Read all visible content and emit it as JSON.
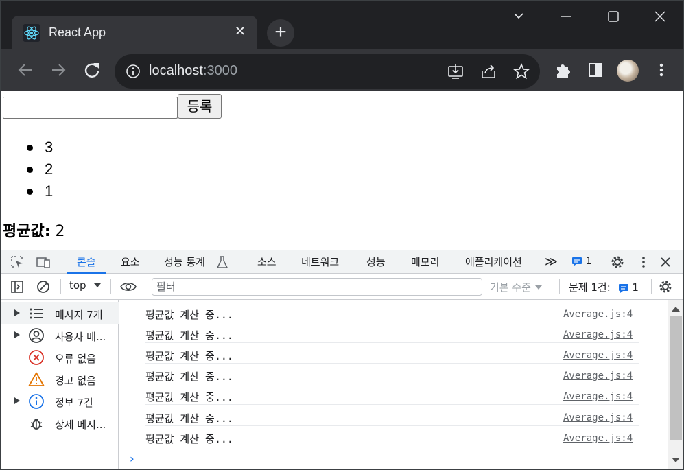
{
  "browser": {
    "tab_title": "React App",
    "tab_close": "✕",
    "new_tab": "+",
    "url_host": "localhost",
    "url_port": ":3000"
  },
  "page": {
    "input_value": "",
    "submit_label": "등록",
    "items": [
      "3",
      "2",
      "1"
    ],
    "avg_label": "평균값:",
    "avg_value": " 2"
  },
  "devtools": {
    "tabs": [
      "콘솔",
      "요소",
      "성능 통계",
      "소스",
      "네트워크",
      "성능",
      "메모리",
      "애플리케이션"
    ],
    "active_tab": "콘솔",
    "more_tabs": "≫",
    "message_count": "1",
    "context": "top",
    "filter_placeholder": "필터",
    "levels": "기본 수준",
    "issues_label": "문제 1건:",
    "issues_count": "1",
    "sidebar": [
      {
        "label": "메시지 7개",
        "icon": "list-icon"
      },
      {
        "label": "사용자 메...",
        "icon": "user-icon"
      },
      {
        "label": "오류 없음",
        "icon": "error-icon"
      },
      {
        "label": "경고 없음",
        "icon": "warning-icon"
      },
      {
        "label": "정보 7건",
        "icon": "info-icon"
      },
      {
        "label": "상세 메시...",
        "icon": "bug-icon"
      }
    ],
    "logs": [
      {
        "message": "평균값 계산 중...",
        "source": "Average.js:4"
      },
      {
        "message": "평균값 계산 중...",
        "source": "Average.js:4"
      },
      {
        "message": "평균값 계산 중...",
        "source": "Average.js:4"
      },
      {
        "message": "평균값 계산 중...",
        "source": "Average.js:4"
      },
      {
        "message": "평균값 계산 중...",
        "source": "Average.js:4"
      },
      {
        "message": "평균값 계산 중...",
        "source": "Average.js:4"
      },
      {
        "message": "평균값 계산 중...",
        "source": "Average.js:4"
      }
    ],
    "prompt": "›"
  },
  "colors": {
    "accent": "#1a73e8",
    "chrome_dark": "#202124",
    "toolbar": "#35363a"
  }
}
